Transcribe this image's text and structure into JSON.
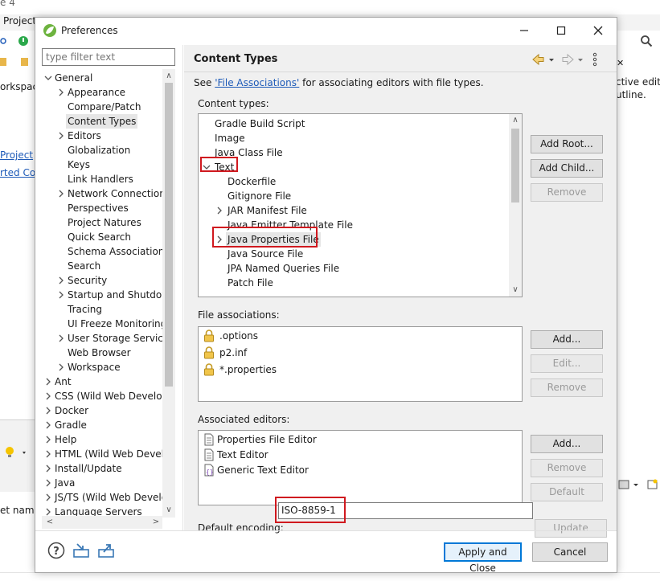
{
  "background": {
    "menu_project": "Project",
    "title_fragment": "e 4",
    "left_items": [
      "orkspace",
      "Project",
      "rted Con"
    ],
    "bottom_left": "et name",
    "right_texts": [
      "ctive edito",
      "utline."
    ]
  },
  "dialog": {
    "title": "Preferences",
    "filter_placeholder": "type filter text",
    "tree": [
      {
        "label": "General",
        "depth": 0,
        "expander": "open"
      },
      {
        "label": "Appearance",
        "depth": 1,
        "expander": "closed"
      },
      {
        "label": "Compare/Patch",
        "depth": 1,
        "expander": "none"
      },
      {
        "label": "Content Types",
        "depth": 1,
        "expander": "none",
        "selected": true
      },
      {
        "label": "Editors",
        "depth": 1,
        "expander": "closed"
      },
      {
        "label": "Globalization",
        "depth": 1,
        "expander": "none"
      },
      {
        "label": "Keys",
        "depth": 1,
        "expander": "none"
      },
      {
        "label": "Link Handlers",
        "depth": 1,
        "expander": "none"
      },
      {
        "label": "Network Connection:",
        "depth": 1,
        "expander": "closed"
      },
      {
        "label": "Perspectives",
        "depth": 1,
        "expander": "none"
      },
      {
        "label": "Project Natures",
        "depth": 1,
        "expander": "none"
      },
      {
        "label": "Quick Search",
        "depth": 1,
        "expander": "none"
      },
      {
        "label": "Schema Associations",
        "depth": 1,
        "expander": "none"
      },
      {
        "label": "Search",
        "depth": 1,
        "expander": "none"
      },
      {
        "label": "Security",
        "depth": 1,
        "expander": "closed"
      },
      {
        "label": "Startup and Shutdow",
        "depth": 1,
        "expander": "closed"
      },
      {
        "label": "Tracing",
        "depth": 1,
        "expander": "none"
      },
      {
        "label": "UI Freeze Monitoring",
        "depth": 1,
        "expander": "none"
      },
      {
        "label": "User Storage Service",
        "depth": 1,
        "expander": "closed"
      },
      {
        "label": "Web Browser",
        "depth": 1,
        "expander": "none"
      },
      {
        "label": "Workspace",
        "depth": 1,
        "expander": "closed"
      },
      {
        "label": "Ant",
        "depth": 0,
        "expander": "closed"
      },
      {
        "label": "CSS (Wild Web Develop",
        "depth": 0,
        "expander": "closed"
      },
      {
        "label": "Docker",
        "depth": 0,
        "expander": "closed"
      },
      {
        "label": "Gradle",
        "depth": 0,
        "expander": "closed"
      },
      {
        "label": "Help",
        "depth": 0,
        "expander": "closed"
      },
      {
        "label": "HTML (Wild Web Develo",
        "depth": 0,
        "expander": "closed"
      },
      {
        "label": "Install/Update",
        "depth": 0,
        "expander": "closed"
      },
      {
        "label": "Java",
        "depth": 0,
        "expander": "closed"
      },
      {
        "label": "JS/TS (Wild Web Develo",
        "depth": 0,
        "expander": "closed"
      },
      {
        "label": "Language Servers",
        "depth": 0,
        "expander": "closed"
      }
    ],
    "page": {
      "title": "Content Types",
      "see_prefix": "See ",
      "see_link": "'File Associations'",
      "see_suffix": " for associating editors with file types.",
      "content_types_label": "Content types:",
      "content_types": [
        {
          "label": "Gradle Build Script",
          "depth": 0,
          "expander": "none"
        },
        {
          "label": "Image",
          "depth": 0,
          "expander": "none"
        },
        {
          "label": "Java Class File",
          "depth": 0,
          "expander": "none"
        },
        {
          "label": "Text",
          "depth": 0,
          "expander": "open"
        },
        {
          "label": "Dockerfile",
          "depth": 1,
          "expander": "none"
        },
        {
          "label": "Gitignore File",
          "depth": 1,
          "expander": "none"
        },
        {
          "label": "JAR Manifest File",
          "depth": 1,
          "expander": "closed"
        },
        {
          "label": "Java Emitter Template File",
          "depth": 1,
          "expander": "none"
        },
        {
          "label": "Java Properties File",
          "depth": 1,
          "expander": "closed",
          "selected": true
        },
        {
          "label": "Java Source File",
          "depth": 1,
          "expander": "none"
        },
        {
          "label": "JPA Named Queries File",
          "depth": 1,
          "expander": "none"
        },
        {
          "label": "Patch File",
          "depth": 1,
          "expander": "none"
        }
      ],
      "content_buttons": {
        "add_root": "Add Root...",
        "add_child": "Add Child...",
        "remove": "Remove"
      },
      "file_assoc_label": "File associations:",
      "file_associations": [
        ".options",
        "p2.inf",
        "*.properties"
      ],
      "file_buttons": {
        "add": "Add...",
        "edit": "Edit...",
        "remove": "Remove"
      },
      "editors_label": "Associated editors:",
      "editors": [
        {
          "label": "Properties File Editor",
          "icon": "document-icon"
        },
        {
          "label": "Text Editor",
          "icon": "document-icon"
        },
        {
          "label": "Generic Text Editor",
          "icon": "generic-editor-icon"
        }
      ],
      "editor_buttons": {
        "add": "Add...",
        "remove": "Remove",
        "default": "Default"
      },
      "encoding_label": "Default encoding:",
      "encoding_value": "ISO-8859-1",
      "update_label": "Update"
    },
    "footer": {
      "apply_close": "Apply and Close",
      "cancel": "Cancel"
    }
  },
  "colors": {
    "accent": "#0078d7",
    "highlight": "#d0191f",
    "link": "#1d5ab8"
  }
}
